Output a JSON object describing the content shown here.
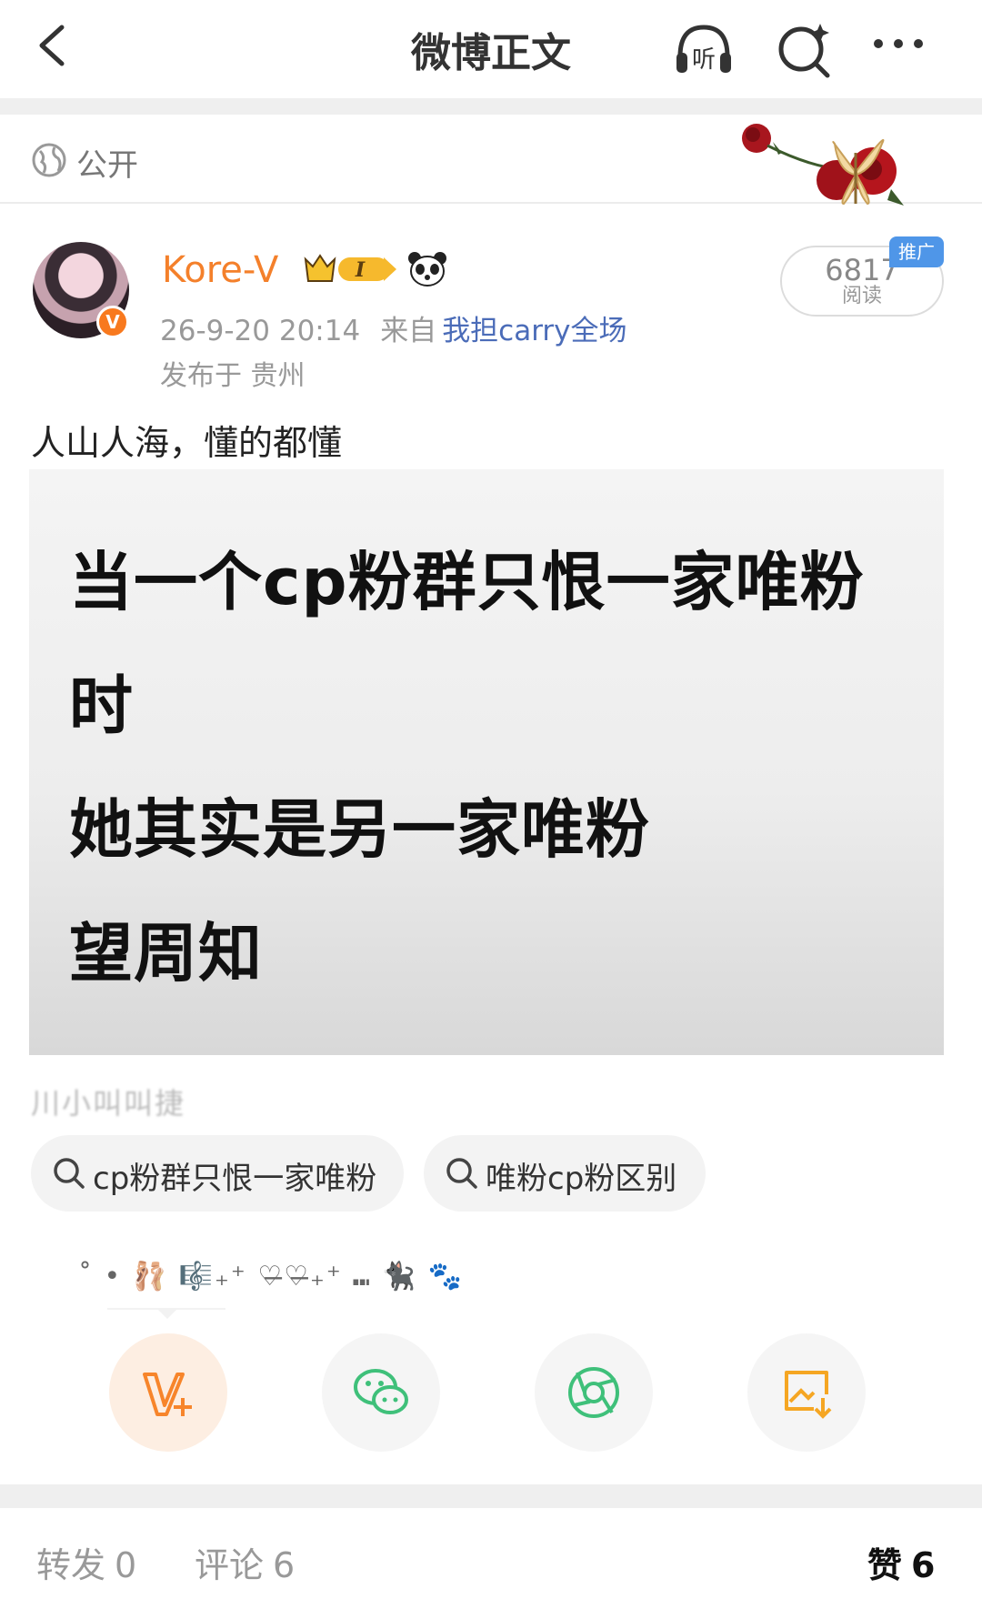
{
  "header": {
    "title": "微博正文",
    "listen_label": "听"
  },
  "visibility": {
    "label": "公开"
  },
  "post": {
    "username": "Kore-V",
    "vip_letter": "I",
    "verify_mark": "V",
    "date": "26-9-20 20:14",
    "from_label": "来自",
    "source": "我担carry全场",
    "location": "发布于 贵州",
    "read_count": "6817",
    "read_label": "阅读",
    "promo_label": "推广",
    "text": "人山人海，懂的都懂",
    "image_lines": [
      "当一个cp粉群只恨一家唯粉",
      "时",
      "她其实是另一家唯粉",
      "望周知"
    ],
    "blurred_caption": "川小叫叫捷"
  },
  "search_chips": [
    {
      "label": "cp粉群只恨一家唯粉"
    },
    {
      "label": "唯粉cp粉区别"
    }
  ],
  "emoji_line": "˚ • 🩰 🎼₊⁺ ♡̶♡̶₊⁺ ⑉ 🐈‍⬛ 🐾",
  "share_buttons": [
    {
      "name": "weibo-v-plus",
      "color": "#f7852b"
    },
    {
      "name": "wechat",
      "color": "#3fc07a"
    },
    {
      "name": "moments",
      "color": "#3fc07a"
    },
    {
      "name": "save-image",
      "color": "#f5a623"
    }
  ],
  "tabs": {
    "repost_label": "转发",
    "repost_count": "0",
    "comment_label": "评论",
    "comment_count": "6",
    "like_label": "赞",
    "like_count": "6"
  }
}
